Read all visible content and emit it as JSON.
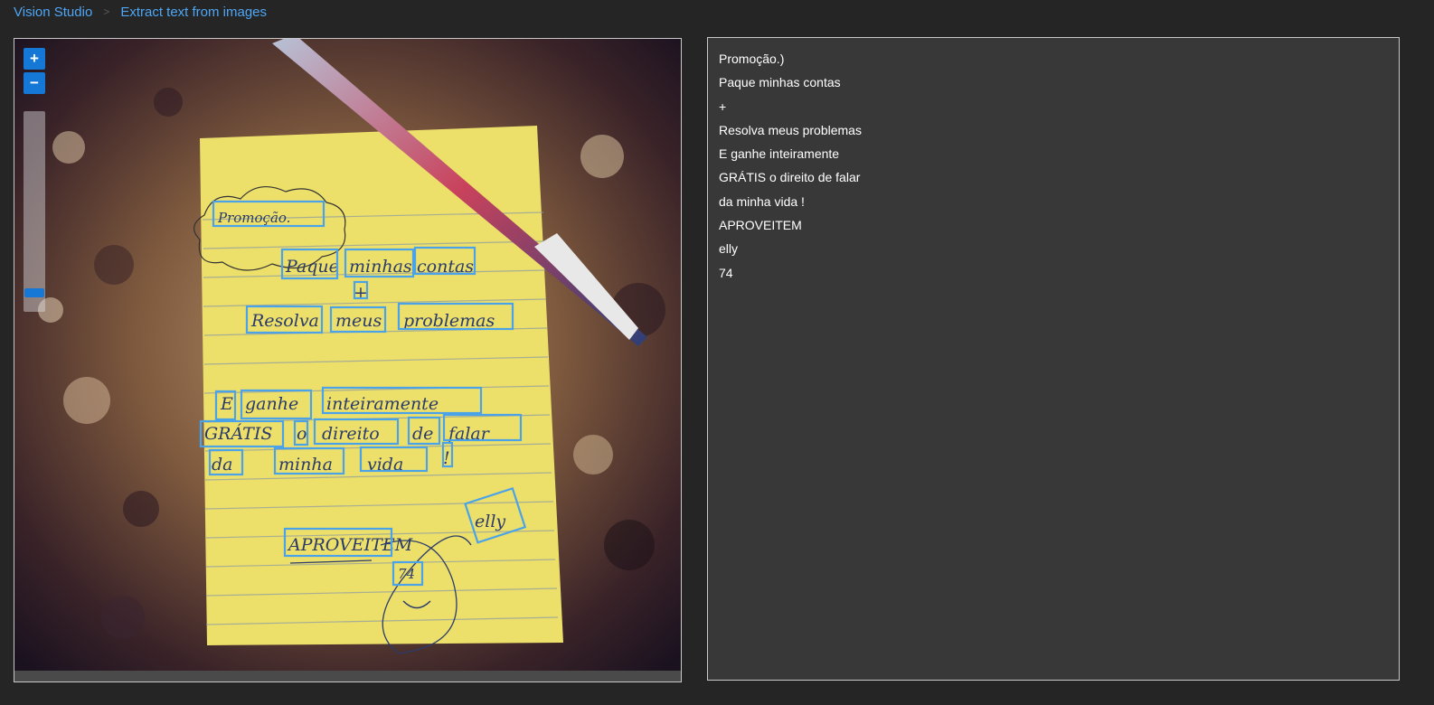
{
  "breadcrumb": {
    "home": "Vision Studio",
    "current": "Extract text from images"
  },
  "zoom": {
    "in_label": "+",
    "out_label": "−",
    "level": 0.08
  },
  "colors": {
    "accent": "#1578d6",
    "link": "#4ea6f5",
    "ocr_box": "#4aa3e8",
    "note": "#eadf68"
  },
  "image": {
    "note_text": {
      "line1": "Promoção.",
      "line2": [
        "Paque",
        "minhas",
        "contas"
      ],
      "line3": "+",
      "line4": [
        "Resolva",
        "meus",
        "problemas"
      ],
      "line5": [
        "E",
        "ganhe",
        "inteiramente"
      ],
      "line6": [
        "GRÁTIS",
        "o",
        "direito",
        "de",
        "falar"
      ],
      "line7": [
        "da",
        "minha",
        "vida",
        "!"
      ],
      "line8": "APROVEITEM",
      "signature": "elly",
      "number": "74"
    }
  },
  "result_lines": [
    "Promoção.)",
    "Paque minhas contas",
    "+",
    "Resolva meus problemas",
    "E ganhe inteiramente",
    "GRÁTIS o direito de falar",
    "da minha vida !",
    "APROVEITEM",
    "elly",
    "74"
  ]
}
